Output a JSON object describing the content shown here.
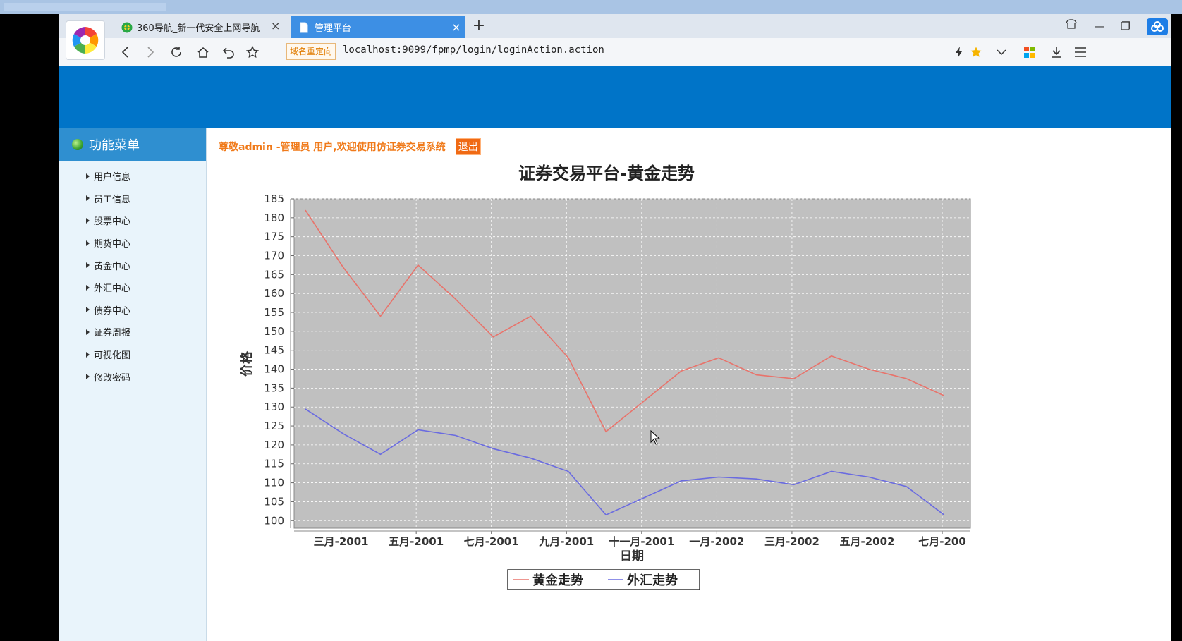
{
  "browser": {
    "tabs": [
      {
        "label": "360导航_新一代安全上网导航",
        "icon": "360-nav-icon"
      },
      {
        "label": "管理平台",
        "icon": "page-icon"
      }
    ],
    "redirect_badge": "域名重定向",
    "url": "localhost:9099/fpmp/login/loginAction.action"
  },
  "sidebar": {
    "title": "功能菜单",
    "items": [
      {
        "label": "用户信息"
      },
      {
        "label": "员工信息"
      },
      {
        "label": "股票中心"
      },
      {
        "label": "期货中心"
      },
      {
        "label": "黄金中心"
      },
      {
        "label": "外汇中心"
      },
      {
        "label": "债券中心"
      },
      {
        "label": "证券周报"
      },
      {
        "label": "可视化图"
      },
      {
        "label": "修改密码"
      }
    ]
  },
  "header": {
    "welcome": "尊敬admin -管理员 用户,欢迎使用仿证券交易系统",
    "logout": "退出"
  },
  "colors": {
    "banner": "#0074c8",
    "gold_line": "#e8736b",
    "forex_line": "#6a6be0",
    "plot_bg": "#c0c0c0"
  },
  "chart_data": {
    "type": "line",
    "title": "证券交易平台-黄金走势",
    "xlabel": "日期",
    "ylabel": "价格",
    "ylim": [
      98,
      185
    ],
    "yticks": [
      100,
      105,
      110,
      115,
      120,
      125,
      130,
      135,
      140,
      145,
      150,
      155,
      160,
      165,
      170,
      175,
      180,
      185
    ],
    "xlim": [
      0,
      18
    ],
    "xticks": [
      {
        "x": 1.25,
        "label": "三月-2001"
      },
      {
        "x": 3.25,
        "label": "五月-2001"
      },
      {
        "x": 5.25,
        "label": "七月-2001"
      },
      {
        "x": 7.25,
        "label": "九月-2001"
      },
      {
        "x": 9.25,
        "label": "十一月-2001"
      },
      {
        "x": 11.25,
        "label": "一月-2002"
      },
      {
        "x": 13.25,
        "label": "三月-2002"
      },
      {
        "x": 15.25,
        "label": "五月-2002"
      },
      {
        "x": 17.25,
        "label": "七月-200"
      }
    ],
    "grid": true,
    "legend": "bottom",
    "x": [
      0.3,
      1.3,
      2.3,
      3.3,
      4.3,
      5.3,
      6.3,
      7.3,
      8.3,
      9.3,
      10.3,
      11.3,
      12.3,
      13.3,
      14.3,
      15.3,
      16.3,
      17.3
    ],
    "series": [
      {
        "name": "黄金走势",
        "color": "#e8736b",
        "values": [
          182,
          167,
          154,
          167.5,
          158.5,
          148.5,
          154,
          143,
          123.5,
          131.5,
          139.5,
          143,
          138.5,
          137.5,
          143.5,
          140,
          137.5,
          133
        ]
      },
      {
        "name": "外汇走势",
        "color": "#6a6be0",
        "values": [
          129.5,
          123,
          117.5,
          124,
          122.5,
          119,
          116.5,
          113,
          101.5,
          106,
          110.5,
          111.5,
          111,
          109.5,
          113,
          111.5,
          109,
          101.5
        ]
      }
    ]
  }
}
